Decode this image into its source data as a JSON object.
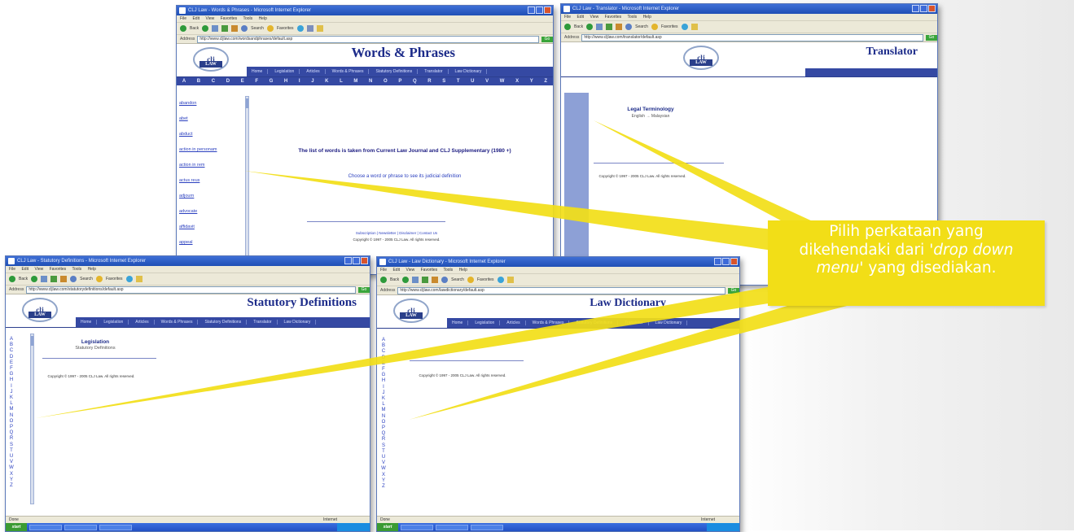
{
  "callout": {
    "line1": "Pilih perkataan yang",
    "line2_prefix": "dikehendaki dari ",
    "line2_italic": "'drop down",
    "line3_italic": "menu'",
    "line3_suffix": " yang disediakan."
  },
  "windows": {
    "words": {
      "title": "CLJ Law - Words & Phrases - Microsoft Internet Explorer",
      "address": "http://www.cljlaw.com/wordsandphrases/default.asp",
      "heading": "Words & Phrases",
      "alphabet": [
        "A",
        "B",
        "C",
        "D",
        "E",
        "F",
        "G",
        "H",
        "I",
        "J",
        "K",
        "L",
        "M",
        "N",
        "O",
        "P",
        "Q",
        "R",
        "S",
        "T",
        "U",
        "V",
        "W",
        "X",
        "Y",
        "Z"
      ],
      "sidebar_links": [
        "abandon",
        "abet",
        "abduct",
        "action in personam",
        "action in rem",
        "actus reus",
        "adjourn",
        "advocate",
        "affidavit",
        "appeal"
      ],
      "main_message": "The list of words is taken from Current Law Journal and CLJ Supplementary (1980 +)",
      "sub_message": "Choose a word or phrase to see its judicial definition",
      "footer_links": "Subscription | Newsletter | Disclaimer | Contact Us",
      "copyright": "Copyright © 1997 - 2005 CLJ Law. All rights reserved."
    },
    "translator": {
      "title": "CLJ Law - Translator - Microsoft Internet Explorer",
      "address": "http://www.cljlaw.com/translator/default.asp",
      "heading": "Translator",
      "panel_title": "Legal Terminology",
      "panel_sub": "English → Malaysian",
      "copyright": "Copyright © 1997 - 2005 CLJ Law. All rights reserved."
    },
    "statutory": {
      "title": "CLJ Law - Statutory Definitions - Microsoft Internet Explorer",
      "address": "http://www.cljlaw.com/statutorydefinitions/default.asp",
      "heading": "Statutory Definitions",
      "panel_title": "Legislation",
      "panel_sub": "Statutory Definitions",
      "copyright": "Copyright © 1997 - 2005 CLJ Law. All rights reserved.",
      "status": "Done",
      "zone": "Internet"
    },
    "dictionary": {
      "title": "CLJ Law - Law Dictionary - Microsoft Internet Explorer",
      "address": "http://www.cljlaw.com/lawdictionary/default.asp",
      "heading": "Law Dictionary",
      "copyright": "Copyright © 1997 - 2005 CLJ Law. All rights reserved.",
      "status": "Done",
      "zone": "Internet"
    }
  },
  "common": {
    "menu": [
      "File",
      "Edit",
      "View",
      "Favorites",
      "Tools",
      "Help"
    ],
    "toolbar": [
      "Back",
      "Search",
      "Favorites"
    ],
    "go_label": "Go",
    "address_label": "Address",
    "logo_text": "clj",
    "logo_law": "LAW",
    "nav_items": [
      "Home",
      "Legislation",
      "Articles",
      "Words & Phrases",
      "Statutory Definitions",
      "Translator",
      "Law Dictionary"
    ],
    "start_label": "start"
  },
  "colors": {
    "callout_yellow": "#f2de17",
    "site_blue": "#3549a3",
    "xp_title_blue": "#2a5bd0"
  }
}
